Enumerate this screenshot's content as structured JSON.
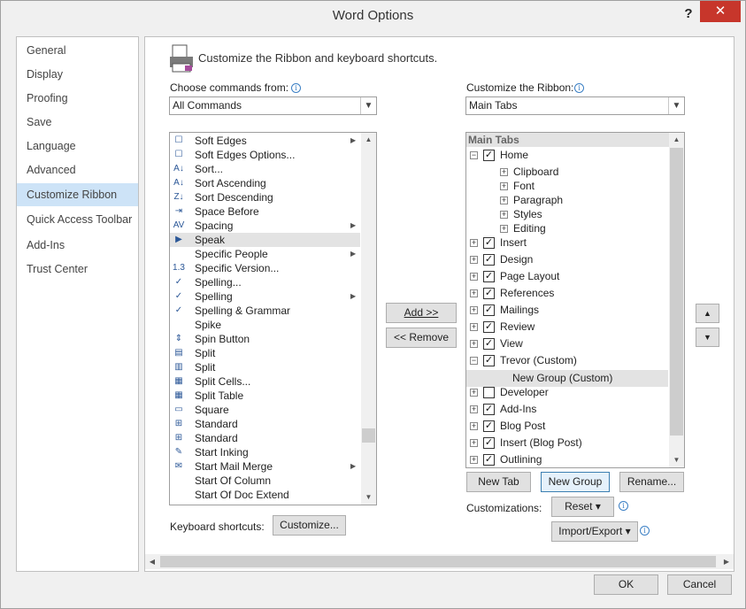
{
  "window": {
    "title": "Word Options",
    "help": "?",
    "close": "✕"
  },
  "nav": {
    "items": [
      {
        "label": "General",
        "top": 0,
        "sel": false
      },
      {
        "label": "Display",
        "sel": false
      },
      {
        "label": "Proofing",
        "sel": false
      },
      {
        "label": "Save",
        "sel": false
      },
      {
        "label": "Language",
        "sel": false
      },
      {
        "label": "Advanced",
        "sel": false
      },
      {
        "label": "Customize Ribbon",
        "sel": true
      },
      {
        "label": "Quick Access Toolbar",
        "sel": false
      },
      {
        "label": "Add-Ins",
        "sel": false
      },
      {
        "label": "Trust Center",
        "sel": false
      }
    ]
  },
  "main": {
    "heading": "Customize the Ribbon and keyboard shortcuts.",
    "choose_label": "Choose commands from:",
    "choose_value": "All Commands",
    "customize_label": "Customize the Ribbon:",
    "customize_value": "Main Tabs",
    "add_button": "Add >>",
    "remove_button": "<< Remove",
    "keyboard_label": "Keyboard shortcuts:",
    "customize_button": "Customize...",
    "new_tab": "New Tab",
    "new_group": "New Group",
    "rename": "Rename...",
    "customizations_label": "Customizations:",
    "reset": "Reset ▾",
    "import_export": "Import/Export ▾",
    "ok": "OK",
    "cancel": "Cancel",
    "up": "▲",
    "down": "▼"
  },
  "commands": [
    {
      "label": "Soft Edges",
      "icon": "☐",
      "sub": true
    },
    {
      "label": "Soft Edges Options...",
      "icon": "☐",
      "sub": false
    },
    {
      "label": "Sort...",
      "icon": "A↓",
      "sub": false
    },
    {
      "label": "Sort Ascending",
      "icon": "A↓",
      "sub": false
    },
    {
      "label": "Sort Descending",
      "icon": "Z↓",
      "sub": false
    },
    {
      "label": "Space Before",
      "icon": "⇥",
      "sub": false
    },
    {
      "label": "Spacing",
      "icon": "AV",
      "sub": true
    },
    {
      "label": "Speak",
      "icon": "▶",
      "sub": false,
      "sel": true
    },
    {
      "label": "Specific People",
      "icon": "",
      "sub": true
    },
    {
      "label": "Specific Version...",
      "icon": "1.3",
      "sub": false
    },
    {
      "label": "Spelling...",
      "icon": "✓",
      "sub": false
    },
    {
      "label": "Spelling",
      "icon": "✓",
      "sub": true
    },
    {
      "label": "Spelling & Grammar",
      "icon": "✓",
      "sub": false
    },
    {
      "label": "Spike",
      "icon": "",
      "sub": false
    },
    {
      "label": "Spin Button",
      "icon": "⇕",
      "sub": false
    },
    {
      "label": "Split",
      "icon": "▤",
      "sub": false
    },
    {
      "label": "Split",
      "icon": "▥",
      "sub": false
    },
    {
      "label": "Split Cells...",
      "icon": "▦",
      "sub": false
    },
    {
      "label": "Split Table",
      "icon": "▦",
      "sub": false
    },
    {
      "label": "Square",
      "icon": "▭",
      "sub": false
    },
    {
      "label": "Standard",
      "icon": "⊞",
      "sub": false
    },
    {
      "label": "Standard",
      "icon": "⊞",
      "sub": false
    },
    {
      "label": "Start Inking",
      "icon": "✎",
      "sub": false
    },
    {
      "label": "Start Mail Merge",
      "icon": "✉",
      "sub": true
    },
    {
      "label": "Start Of Column",
      "icon": "",
      "sub": false
    },
    {
      "label": "Start Of Doc Extend",
      "icon": "",
      "sub": false
    }
  ],
  "tree": {
    "header": "Main Tabs",
    "rows": [
      {
        "label": "Home",
        "level": 0,
        "exp": "−",
        "check": true
      },
      {
        "label": "Clipboard",
        "level": 1,
        "exp": "+",
        "check": null
      },
      {
        "label": "Font",
        "level": 1,
        "exp": "+",
        "check": null
      },
      {
        "label": "Paragraph",
        "level": 1,
        "exp": "+",
        "check": null
      },
      {
        "label": "Styles",
        "level": 1,
        "exp": "+",
        "check": null
      },
      {
        "label": "Editing",
        "level": 1,
        "exp": "+",
        "check": null
      },
      {
        "label": "Insert",
        "level": 0,
        "exp": "+",
        "check": true
      },
      {
        "label": "Design",
        "level": 0,
        "exp": "+",
        "check": true
      },
      {
        "label": "Page Layout",
        "level": 0,
        "exp": "+",
        "check": true
      },
      {
        "label": "References",
        "level": 0,
        "exp": "+",
        "check": true
      },
      {
        "label": "Mailings",
        "level": 0,
        "exp": "+",
        "check": true
      },
      {
        "label": "Review",
        "level": 0,
        "exp": "+",
        "check": true
      },
      {
        "label": "View",
        "level": 0,
        "exp": "+",
        "check": true
      },
      {
        "label": "Trevor (Custom)",
        "level": 0,
        "exp": "−",
        "check": true
      },
      {
        "label": "New Group (Custom)",
        "level": 2,
        "exp": "",
        "check": null,
        "sel": true
      },
      {
        "label": "Developer",
        "level": 0,
        "exp": "+",
        "check": false
      },
      {
        "label": "Add-Ins",
        "level": 0,
        "exp": "+",
        "check": true
      },
      {
        "label": "Blog Post",
        "level": 0,
        "exp": "+",
        "check": true
      },
      {
        "label": "Insert (Blog Post)",
        "level": 0,
        "exp": "+",
        "check": true
      },
      {
        "label": "Outlining",
        "level": 0,
        "exp": "+",
        "check": true
      }
    ]
  }
}
